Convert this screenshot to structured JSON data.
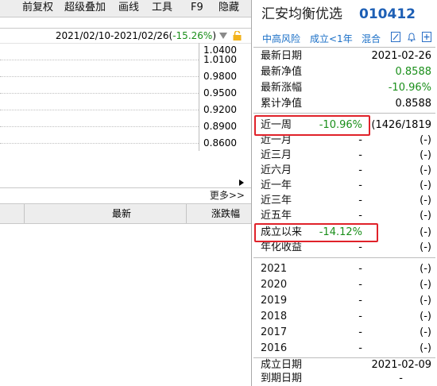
{
  "menubar": {
    "items": [
      "前复权",
      "超级叠加",
      "画线",
      "工具",
      "F9",
      "隐藏"
    ]
  },
  "chart": {
    "date_range": "2021/02/10-2021/02/26",
    "range_change_prefix": "(",
    "range_change": "-15.26%",
    "range_change_suffix": ")",
    "y_ticks": [
      "1.0400",
      "1.0100",
      "0.9800",
      "0.9500",
      "0.9200",
      "0.8900",
      "0.8600"
    ]
  },
  "more_link": "更多>>",
  "table_header": {
    "col_latest": "最新",
    "col_change": "涨跌幅"
  },
  "fund": {
    "name": "汇安均衡优选",
    "code": "010412",
    "tags": [
      "中高风险",
      "成立<1年",
      "混合"
    ],
    "toolbar_icons": [
      "edit-icon",
      "bell-icon",
      "plus-icon"
    ],
    "summary": [
      {
        "label": "最新日期",
        "value": "2021-02-26"
      },
      {
        "label": "最新净值",
        "value": "0.8588"
      },
      {
        "label": "最新涨幅",
        "value": "-10.96%"
      },
      {
        "label": "累计净值",
        "value": "0.8588"
      }
    ],
    "periods": [
      {
        "label": "近一周",
        "value": "-10.96%",
        "rank": "(1426/1819"
      },
      {
        "label": "近一月",
        "value": "-",
        "rank": "(-)"
      },
      {
        "label": "近三月",
        "value": "-",
        "rank": "(-)"
      },
      {
        "label": "近六月",
        "value": "-",
        "rank": "(-)"
      },
      {
        "label": "近一年",
        "value": "-",
        "rank": "(-)"
      },
      {
        "label": "近三年",
        "value": "-",
        "rank": "(-)"
      },
      {
        "label": "近五年",
        "value": "-",
        "rank": "(-)"
      },
      {
        "label": "成立以来",
        "value": "-14.12%",
        "rank": "(-)"
      },
      {
        "label": "年化收益",
        "value": "-",
        "rank": "(-)"
      }
    ],
    "years": [
      {
        "label": "2021",
        "value": "-",
        "rank": "(-)"
      },
      {
        "label": "2020",
        "value": "-",
        "rank": "(-)"
      },
      {
        "label": "2019",
        "value": "-",
        "rank": "(-)"
      },
      {
        "label": "2018",
        "value": "-",
        "rank": "(-)"
      },
      {
        "label": "2017",
        "value": "-",
        "rank": "(-)"
      },
      {
        "label": "2016",
        "value": "-",
        "rank": "(-)"
      }
    ],
    "footer": [
      {
        "label": "成立日期",
        "value": "2021-02-09"
      },
      {
        "label": "到期日期",
        "value": "-"
      }
    ]
  },
  "colors": {
    "accent_blue": "#1d5fb5",
    "negative_green": "#1a8f1a",
    "highlight_red": "#e0222a"
  }
}
